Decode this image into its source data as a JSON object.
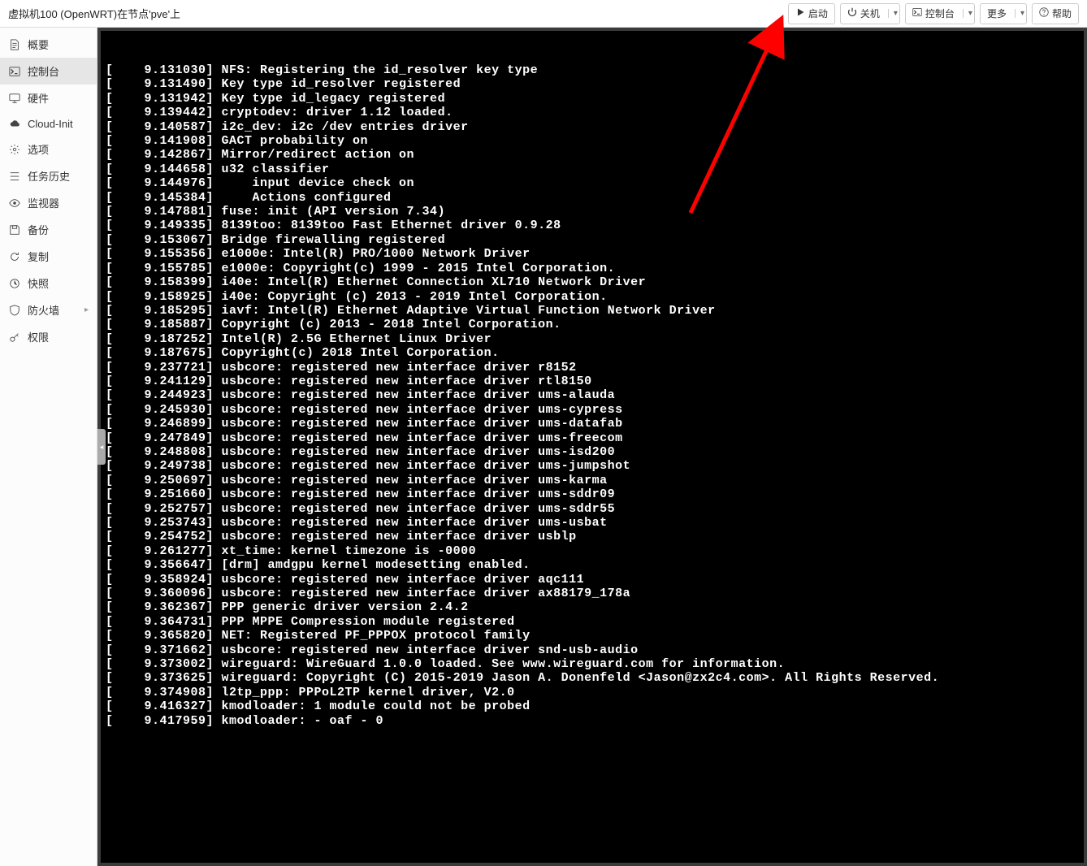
{
  "header": {
    "title": "虚拟机100 (OpenWRT)在节点'pve'上",
    "buttons": {
      "start": "启动",
      "shutdown": "关机",
      "console": "控制台",
      "more": "更多",
      "help": "帮助"
    }
  },
  "sidebar": {
    "items": [
      {
        "key": "summary",
        "label": "概要",
        "icon": "doc"
      },
      {
        "key": "console",
        "label": "控制台",
        "icon": "terminal",
        "selected": true
      },
      {
        "key": "hardware",
        "label": "硬件",
        "icon": "monitor"
      },
      {
        "key": "cloudinit",
        "label": "Cloud-Init",
        "icon": "cloud"
      },
      {
        "key": "options",
        "label": "选项",
        "icon": "gear"
      },
      {
        "key": "taskhistory",
        "label": "任务历史",
        "icon": "list"
      },
      {
        "key": "monitor",
        "label": "监视器",
        "icon": "eye"
      },
      {
        "key": "backup",
        "label": "备份",
        "icon": "save"
      },
      {
        "key": "replication",
        "label": "复制",
        "icon": "refresh"
      },
      {
        "key": "snapshot",
        "label": "快照",
        "icon": "history"
      },
      {
        "key": "firewall",
        "label": "防火墙",
        "icon": "shield",
        "hasChildren": true
      },
      {
        "key": "permissions",
        "label": "权限",
        "icon": "key"
      }
    ]
  },
  "console": {
    "lines": [
      "[    9.131030] NFS: Registering the id_resolver key type",
      "[    9.131490] Key type id_resolver registered",
      "[    9.131942] Key type id_legacy registered",
      "[    9.139442] cryptodev: driver 1.12 loaded.",
      "[    9.140587] i2c_dev: i2c /dev entries driver",
      "[    9.141908] GACT probability on",
      "[    9.142867] Mirror/redirect action on",
      "[    9.144658] u32 classifier",
      "[    9.144976]     input device check on",
      "[    9.145384]     Actions configured",
      "[    9.147881] fuse: init (API version 7.34)",
      "[    9.149335] 8139too: 8139too Fast Ethernet driver 0.9.28",
      "[    9.153067] Bridge firewalling registered",
      "[    9.155356] e1000e: Intel(R) PRO/1000 Network Driver",
      "[    9.155785] e1000e: Copyright(c) 1999 - 2015 Intel Corporation.",
      "[    9.158399] i40e: Intel(R) Ethernet Connection XL710 Network Driver",
      "[    9.158925] i40e: Copyright (c) 2013 - 2019 Intel Corporation.",
      "[    9.185295] iavf: Intel(R) Ethernet Adaptive Virtual Function Network Driver",
      "[    9.185887] Copyright (c) 2013 - 2018 Intel Corporation.",
      "[    9.187252] Intel(R) 2.5G Ethernet Linux Driver",
      "[    9.187675] Copyright(c) 2018 Intel Corporation.",
      "[    9.237721] usbcore: registered new interface driver r8152",
      "[    9.241129] usbcore: registered new interface driver rtl8150",
      "[    9.244923] usbcore: registered new interface driver ums-alauda",
      "[    9.245930] usbcore: registered new interface driver ums-cypress",
      "[    9.246899] usbcore: registered new interface driver ums-datafab",
      "[    9.247849] usbcore: registered new interface driver ums-freecom",
      "[    9.248808] usbcore: registered new interface driver ums-isd200",
      "[    9.249738] usbcore: registered new interface driver ums-jumpshot",
      "[    9.250697] usbcore: registered new interface driver ums-karma",
      "[    9.251660] usbcore: registered new interface driver ums-sddr09",
      "[    9.252757] usbcore: registered new interface driver ums-sddr55",
      "[    9.253743] usbcore: registered new interface driver ums-usbat",
      "[    9.254752] usbcore: registered new interface driver usblp",
      "[    9.261277] xt_time: kernel timezone is -0000",
      "[    9.356647] [drm] amdgpu kernel modesetting enabled.",
      "[    9.358924] usbcore: registered new interface driver aqc111",
      "[    9.360096] usbcore: registered new interface driver ax88179_178a",
      "[    9.362367] PPP generic driver version 2.4.2",
      "[    9.364731] PPP MPPE Compression module registered",
      "[    9.365820] NET: Registered PF_PPPOX protocol family",
      "[    9.371662] usbcore: registered new interface driver snd-usb-audio",
      "[    9.373002] wireguard: WireGuard 1.0.0 loaded. See www.wireguard.com for information.",
      "[    9.373625] wireguard: Copyright (C) 2015-2019 Jason A. Donenfeld <Jason@zx2c4.com>. All Rights Reserved.",
      "[    9.374908] l2tp_ppp: PPPoL2TP kernel driver, V2.0",
      "[    9.416327] kmodloader: 1 module could not be probed",
      "[    9.417959] kmodloader: - oaf - 0"
    ]
  }
}
